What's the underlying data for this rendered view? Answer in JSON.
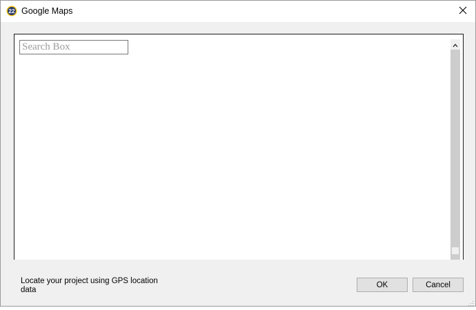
{
  "window": {
    "title": "Google Maps",
    "app_icon": "app-logo-icon",
    "app_icon_text": "22"
  },
  "map": {
    "search_placeholder": "Search Box",
    "search_value": ""
  },
  "footer": {
    "status_text": "Locate your project using GPS location data",
    "ok_label": "OK",
    "cancel_label": "Cancel"
  },
  "colors": {
    "dialog_bg": "#f0f0f0",
    "titlebar_bg": "#ffffff",
    "button_bg": "#e1e1e1",
    "button_border": "#adadad",
    "scroll_track": "#cdcdcd",
    "app_icon_blue": "#2b5797",
    "app_icon_yellow": "#f5c518"
  }
}
